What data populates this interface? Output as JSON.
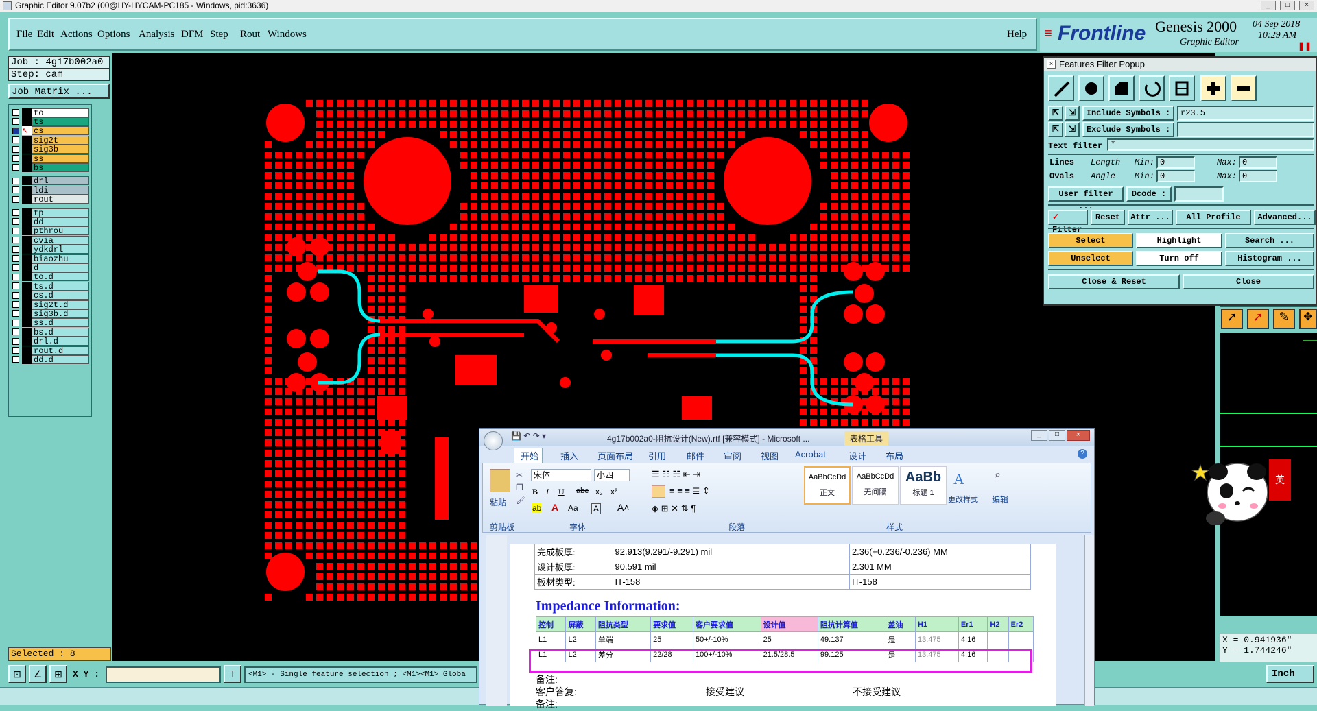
{
  "window": {
    "title": "Graphic Editor 9.07b2 (00@HY-HYCAM-PC185 - Windows, pid:3636)"
  },
  "menu": {
    "items": [
      "File",
      "Edit",
      "Actions",
      "Options",
      "Analysis",
      "DFM",
      "Step",
      "Rout",
      "Windows"
    ],
    "help": "Help"
  },
  "brand": {
    "logo": "Frontline",
    "product": "Genesis 2000",
    "subtitle": "Graphic Editor",
    "date": "04 Sep 2018",
    "time": "10:29 AM"
  },
  "job": {
    "job": "Job : 4g17b002a0",
    "step": "Step: cam",
    "matrix": "Job Matrix ..."
  },
  "layers": [
    {
      "name": "to",
      "color": "#ffffff"
    },
    {
      "name": "ts",
      "color": "#1aa67e"
    },
    {
      "name": "cs",
      "color": "#f7c048",
      "active": true
    },
    {
      "name": "sig2t",
      "color": "#f7c048"
    },
    {
      "name": "sig3b",
      "color": "#f7c048"
    },
    {
      "name": "ss",
      "color": "#f7c048"
    },
    {
      "name": "bs",
      "color": "#1aa67e"
    },
    {
      "name": "drl",
      "color": "#aac0c8"
    },
    {
      "name": "ldi",
      "color": "#aac0c8"
    },
    {
      "name": "rout",
      "color": "#e0e8e8"
    },
    {
      "name": "tp",
      "color": "#9fe3e3"
    },
    {
      "name": "dd",
      "color": "#9fe3e3"
    },
    {
      "name": "pthrou",
      "color": "#9fe3e3"
    },
    {
      "name": "cvia",
      "color": "#9fe3e3"
    },
    {
      "name": "ydkdrl",
      "color": "#9fe3e3"
    },
    {
      "name": "biaozhu",
      "color": "#9fe3e3"
    },
    {
      "name": "d",
      "color": "#9fe3e3"
    },
    {
      "name": "to.d",
      "color": "#9fe3e3"
    },
    {
      "name": "ts.d",
      "color": "#9fe3e3"
    },
    {
      "name": "cs.d",
      "color": "#9fe3e3"
    },
    {
      "name": "sig2t.d",
      "color": "#9fe3e3"
    },
    {
      "name": "sig3b.d",
      "color": "#9fe3e3"
    },
    {
      "name": "ss.d",
      "color": "#9fe3e3"
    },
    {
      "name": "bs.d",
      "color": "#9fe3e3"
    },
    {
      "name": "drl.d",
      "color": "#9fe3e3"
    },
    {
      "name": "rout.d",
      "color": "#9fe3e3"
    },
    {
      "name": "dd.d",
      "color": "#9fe3e3"
    }
  ],
  "selected": "Selected : 8",
  "status": {
    "xy_label": "X Y :",
    "message": "<M1> - Single feature selection ; <M1><M1> Globa",
    "unit": "Inch"
  },
  "coords": {
    "x": "X = 0.941936\"",
    "y": "Y = 1.744246\""
  },
  "filter": {
    "title": "Features Filter Popup",
    "include_label": "Include Symbols :",
    "include_value": "r23.5",
    "exclude_label": "Exclude Symbols :",
    "exclude_value": "",
    "text_filter_label": "Text filter",
    "text_filter_value": "*",
    "lines": "Lines",
    "ovals": "Ovals",
    "length": "Length",
    "angle": "Angle",
    "min": "Min:",
    "max": "Max:",
    "min_val": "0",
    "max_val": "0",
    "user_filter": "User filter ...",
    "dcode": "Dcode :",
    "filter": "Filter",
    "reset": "Reset",
    "attr": "Attr ...",
    "profile": "All Profile",
    "advanced": "Advanced...",
    "select": "Select",
    "highlight": "Highlight",
    "search": "Search ...",
    "unselect": "Unselect",
    "turn_off": "Turn off",
    "histogram": "Histogram ...",
    "close_reset": "Close & Reset",
    "close": "Close"
  },
  "word": {
    "title": "4g17b002a0-阻抗设计(New).rtf [兼容模式] - Microsoft ...",
    "context_tab": "表格工具",
    "tabs": [
      "开始",
      "插入",
      "页面布局",
      "引用",
      "邮件",
      "审阅",
      "视图",
      "Acrobat",
      "设计",
      "布局"
    ],
    "font": "宋体",
    "size": "小四",
    "paste": "粘贴",
    "groups": [
      "剪贴板",
      "字体",
      "段落",
      "样式"
    ],
    "styles": [
      "正文",
      "无间隔",
      "标题 1"
    ],
    "style_sample": "AaBbCcDd",
    "style_big": "AaBb",
    "change_styles": "更改样式",
    "edit": "编辑",
    "info_rows": [
      [
        "完成板厚:",
        "92.913(9.291/-9.291) mil",
        "2.36(+0.236/-0.236) MM"
      ],
      [
        "设计板厚:",
        "90.591 mil",
        "2.301 MM"
      ],
      [
        "板材类型:",
        "IT-158",
        "IT-158"
      ]
    ],
    "heading": "Impedance Information:",
    "imp_headers": [
      "控制",
      "屏蔽",
      "阻抗类型",
      "要求值",
      "客户要求值",
      "设计值",
      "阻抗计算值",
      "盖油",
      "H1",
      "Er1",
      "H2",
      "Er2"
    ],
    "imp_rows": [
      [
        "L1",
        "L2",
        "单端",
        "25",
        "50+/-10%",
        "25",
        "49.137",
        "是",
        "13.475",
        "4.16",
        "",
        ""
      ],
      [
        "L1",
        "L2",
        "差分",
        "22/28",
        "100+/-10%",
        "21.5/28.5",
        "99.125",
        "是",
        "13.475",
        "4.16",
        "",
        ""
      ]
    ],
    "note1": "备注:",
    "reply": "客户答复:",
    "accept": "接受建议",
    "reject": "不接受建议",
    "note2": "备注:"
  },
  "panda": {
    "label": "英"
  }
}
